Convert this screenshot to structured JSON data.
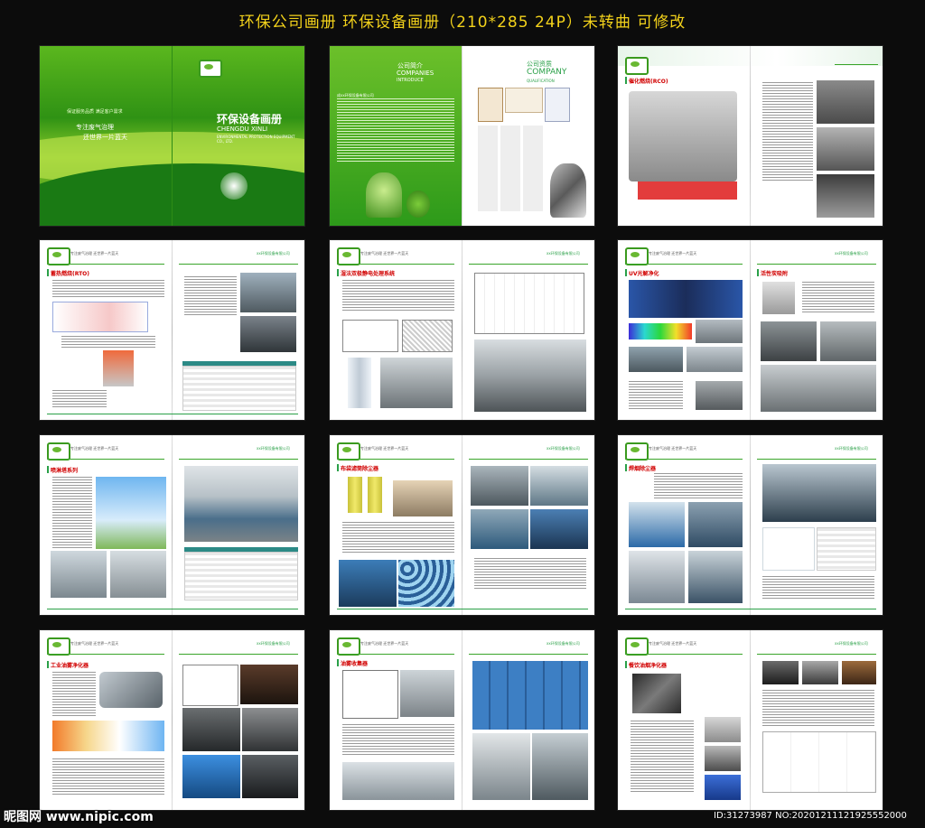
{
  "page_title": "环保公司画册   环保设备画册（210*285  24P）未转曲 可修改",
  "cover": {
    "title": "环保设备画册",
    "company_pinyin": "CHENGDU XINLI",
    "company_en": "ENVIRONMENTAL PROTECTION EQUIPMENT CO., LTD.",
    "slogan_1": "保证服务品质  满足客户需求",
    "slogan_2": "专注废气治理",
    "slogan_3": "还世界一片蓝天"
  },
  "intro": {
    "cn": "公司简介",
    "en1": "COMPANIES",
    "en2": "INTRODUCE",
    "lead": "成xx环保设备有限公司"
  },
  "qualification": {
    "cn": "公司资质",
    "en1": "COMPANY",
    "en2": "QUALIFICATION"
  },
  "header_slogan": "专注废气治理  还世界一片蓝天",
  "header_company": "xx环保设备有限公司",
  "sections": {
    "rco": "催化燃烧(RCO)",
    "rto": "蓄热燃烧(RTO)",
    "esp": "湿法双极静电处理系统",
    "uv": "UV光解净化",
    "carbon": "活性炭吸附",
    "spray": "喷淋塔系列",
    "bag": "布袋滤筒除尘器",
    "weld": "焊烟除尘器",
    "oilmist": "工业油雾净化器",
    "oilcollector": "油雾收集器",
    "kitchen": "餐饮油烟净化器"
  },
  "watermark": {
    "site": "昵图网 www.nipic.com",
    "id": "ID:31273987 NO:20201211121925552000"
  },
  "colors": {
    "title_yellow": "#f3d21b",
    "brand_green": "#2aa048",
    "section_red": "#d10000"
  }
}
